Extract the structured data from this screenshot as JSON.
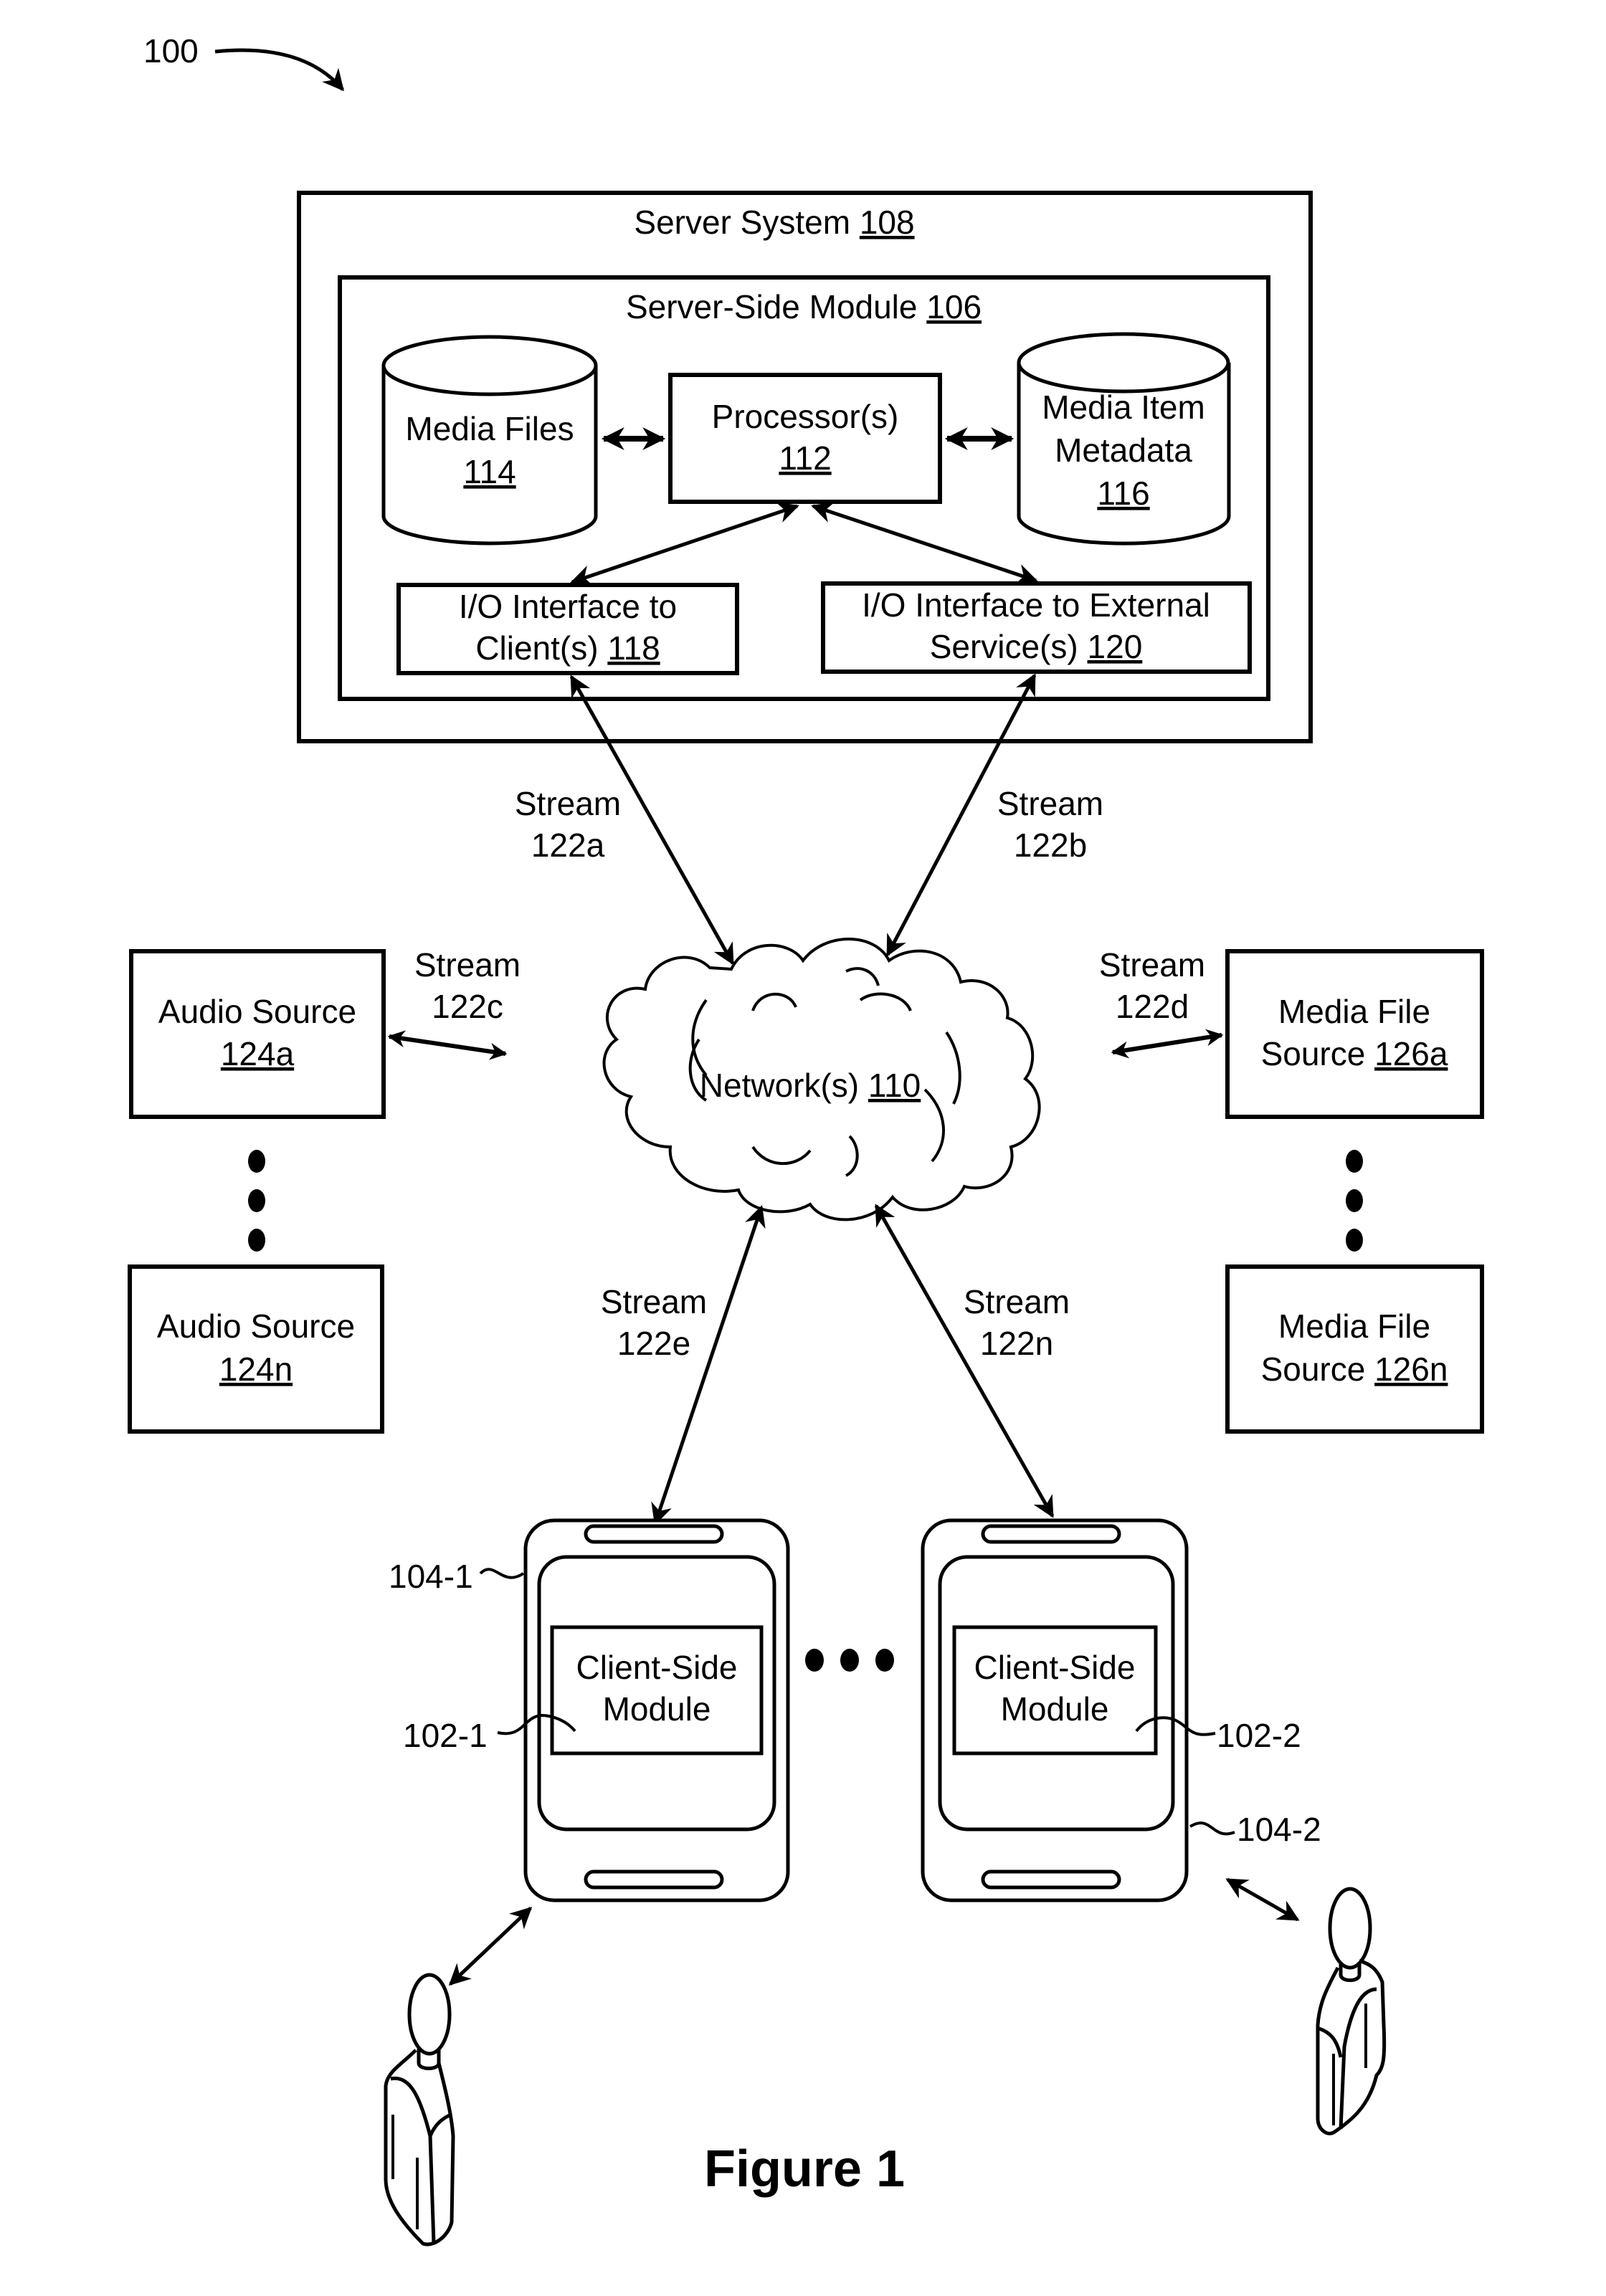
{
  "figure": {
    "ref_label": "100",
    "caption": "Figure 1"
  },
  "server_system": {
    "label": "Server System",
    "ref": "108"
  },
  "server_side_module": {
    "label": "Server-Side Module",
    "ref": "106"
  },
  "media_files": {
    "line1": "Media Files",
    "ref": "114"
  },
  "processor": {
    "line1": "Processor(s)",
    "ref": "112"
  },
  "media_item_metadata": {
    "line1": "Media Item",
    "line2": "Metadata",
    "ref": "116"
  },
  "io_clients": {
    "line1": "I/O Interface to",
    "line2": "Client(s)",
    "ref": "118"
  },
  "io_external": {
    "line1": "I/O Interface to External",
    "line2": "Service(s)",
    "ref": "120"
  },
  "network": {
    "label": "Network(s)",
    "ref": "110"
  },
  "streams": [
    {
      "line1": "Stream",
      "line2": "122a"
    },
    {
      "line1": "Stream",
      "line2": "122b"
    },
    {
      "line1": "Stream",
      "line2": "122c"
    },
    {
      "line1": "Stream",
      "line2": "122d"
    },
    {
      "line1": "Stream",
      "line2": "122e"
    },
    {
      "line1": "Stream",
      "line2": "122n"
    }
  ],
  "audio_sources": [
    {
      "line1": "Audio Source",
      "ref": "124a"
    },
    {
      "line1": "Audio Source",
      "ref": "124n"
    }
  ],
  "media_file_sources": [
    {
      "line1": "Media File",
      "line2": "Source",
      "ref": "126a"
    },
    {
      "line1": "Media File",
      "line2": "Source",
      "ref": "126n"
    }
  ],
  "clients": [
    {
      "device_ref": "104-1",
      "module_line1": "Client-Side",
      "module_line2": "Module",
      "module_ref": "102-1"
    },
    {
      "device_ref": "104-2",
      "module_line1": "Client-Side",
      "module_line2": "Module",
      "module_ref": "102-2"
    }
  ]
}
